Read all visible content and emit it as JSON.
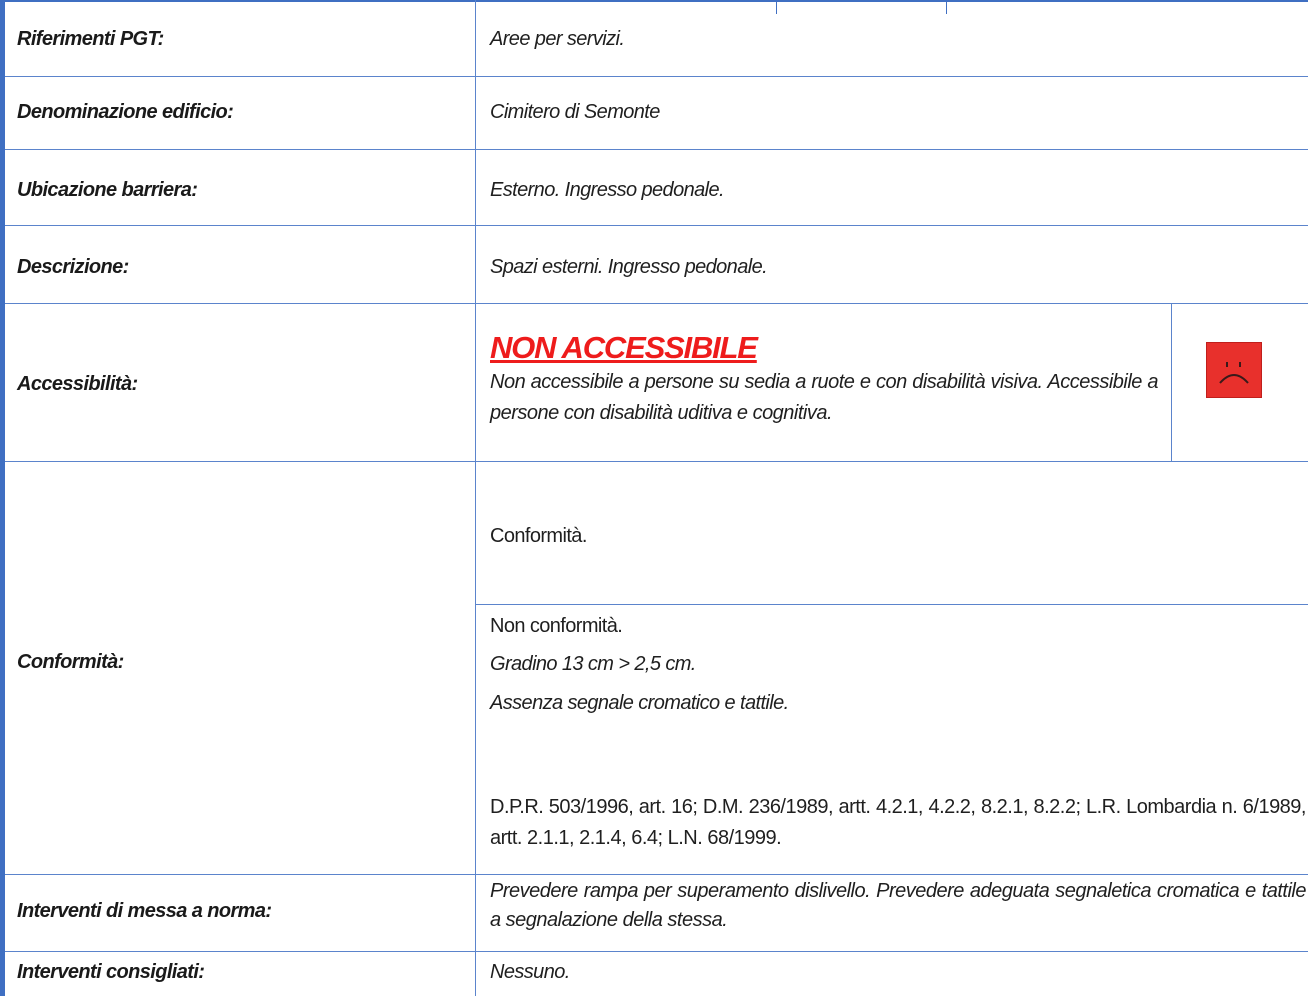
{
  "rows": {
    "riferimenti": {
      "label": "Riferimenti PGT:",
      "value": "Aree per servizi."
    },
    "denominazione": {
      "label": "Denominazione edificio:",
      "value": "Cimitero di Semonte"
    },
    "ubicazione": {
      "label": "Ubicazione barriera:",
      "value": "Esterno. Ingresso pedonale."
    },
    "descrizione": {
      "label": "Descrizione:",
      "value": "Spazi esterni. Ingresso pedonale."
    },
    "accessibilita": {
      "label": "Accessibilità:",
      "status": "NON ACCESSIBILE",
      "text": "Non accessibile a persone su sedia a ruote e con disabilità visiva. Accessibile a persone con disabilità uditiva e cognitiva.",
      "icon": "sad-face-icon",
      "icon_color": "#e8302c"
    },
    "conformita": {
      "label": "Conformità:",
      "conformi_heading": "Conformità.",
      "non_conformi_heading": "Non conformità.",
      "items": [
        "Gradino 13 cm > 2,5 cm.",
        "Assenza segnale cromatico e tattile."
      ],
      "riferimenti_normativi": "D.P.R. 503/1996, art. 16; D.M. 236/1989, artt. 4.2.1, 4.2.2, 8.2.1, 8.2.2; L.R. Lombardia n. 6/1989, artt. 2.1.1, 2.1.4, 6.4; L.N. 68/1999."
    },
    "interventi_norma": {
      "label": "Interventi di messa a norma:",
      "text": "Prevedere rampa per superamento dislivello. Prevedere adeguata segnaletica cromatica e tattile a segnalazione della stessa."
    },
    "interventi_consigliati": {
      "label": "Interventi consigliati:",
      "value": "Nessuno."
    }
  },
  "colors": {
    "border": "#5b84cc",
    "accent_stripe": "#3f6fc2",
    "status_red": "#ee1c1c"
  }
}
